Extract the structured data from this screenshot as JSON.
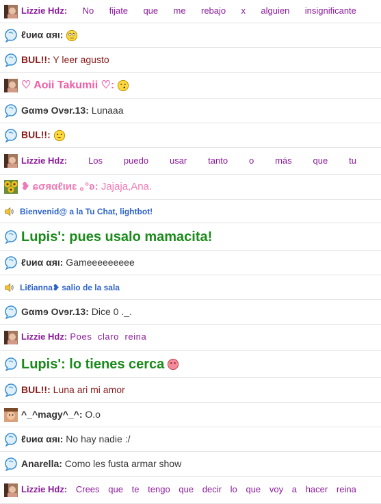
{
  "messages": [
    {
      "type": "chat",
      "avatar": "photo-avatar",
      "nick": "Lizzie Hdz",
      "text": "No fijate que me rebajo x alguien insignificante",
      "color": "#8b1a9b",
      "size": 13,
      "justify": true,
      "words": [
        "Lizzie Hdz:",
        "No",
        "fijate",
        "que",
        "me",
        "rebajo",
        "x",
        "alguien",
        "insignificante"
      ]
    },
    {
      "type": "chat",
      "avatar": "bubble-avatar",
      "nick": "ℓυиα αяι",
      "text": "",
      "emoji": "rolleyes-emoji",
      "color": "#333333",
      "size": 14
    },
    {
      "type": "chat",
      "avatar": "bubble-avatar",
      "nick": "BUL!!",
      "text": "Y leer agusto",
      "color": "#8b1a1a",
      "size": 14
    },
    {
      "type": "chat",
      "avatar": "photo-avatar",
      "nick": "♡ Aoii Takumii ♡",
      "text": "",
      "emoji": "whistle-emoji",
      "color": "#ee5fa5",
      "size": 16
    },
    {
      "type": "chat",
      "avatar": "bubble-avatar",
      "nick": "Gαmɘ Ovɘr.13",
      "text": "Lunaaa",
      "color": "#333333",
      "size": 14
    },
    {
      "type": "chat",
      "avatar": "bubble-avatar",
      "nick": "BUL!!",
      "text": "",
      "emoji": "thinking-emoji",
      "color": "#8b1a1a",
      "size": 14
    },
    {
      "type": "chat",
      "avatar": "photo-avatar",
      "nick": "Lizzie Hdz",
      "text": "Los puedo usar tanto o más que tu",
      "color": "#8b1a9b",
      "size": 13,
      "justify": true,
      "words": [
        "Lizzie Hdz:",
        "Los",
        "puedo",
        "usar",
        "tanto",
        "o",
        "más",
        "que",
        "tu"
      ]
    },
    {
      "type": "chat",
      "avatar": "flower-avatar",
      "nick": "❥ ɕσяαℓιиɛ ｡°ʚ",
      "text": "Jajaja,Ana.",
      "color": "#f07ab6",
      "size": 15
    },
    {
      "type": "system",
      "text": "Bienvenid@ a la Tu Chat, lightbot!"
    },
    {
      "type": "chat",
      "avatar": "bubble-avatar",
      "nick": "Lupis'",
      "text": "pues usalo mamacita!",
      "color": "#1a8a1a",
      "size": 20,
      "bold_text": true
    },
    {
      "type": "chat",
      "avatar": "bubble-avatar",
      "nick": "ℓυиα αяι",
      "text": "Gameeeeeeeee",
      "color": "#333333",
      "size": 14
    },
    {
      "type": "system",
      "text": "Liℓianna❥ salio de la sala"
    },
    {
      "type": "chat",
      "avatar": "bubble-avatar",
      "nick": "Gαmɘ Ovɘr.13",
      "text": "Dice 0 ._.",
      "color": "#333333",
      "size": 14
    },
    {
      "type": "chat",
      "avatar": "photo-avatar",
      "nick": "Lizzie Hdz",
      "text": "Poes claro reina",
      "color": "#8b1a9b",
      "size": 13,
      "words_spaced": true
    },
    {
      "type": "chat",
      "avatar": "bubble-avatar",
      "nick": "Lupis'",
      "text": "lo tienes cerca",
      "emoji": "blush-emoji",
      "color": "#1a8a1a",
      "size": 20,
      "bold_text": true
    },
    {
      "type": "chat",
      "avatar": "bubble-avatar",
      "nick": "BUL!!",
      "text": "Luna ari mi amor",
      "color": "#8b1a1a",
      "size": 14
    },
    {
      "type": "chat",
      "avatar": "face-avatar",
      "nick": "^_^magy^_^",
      "text": "O.o",
      "color": "#333333",
      "size": 14
    },
    {
      "type": "chat",
      "avatar": "bubble-avatar",
      "nick": "ℓυиα αяι",
      "text": "No hay nadie :/",
      "color": "#333333",
      "size": 14
    },
    {
      "type": "chat",
      "avatar": "bubble-avatar",
      "nick": "Anarella",
      "text": "Como les fusta armar show",
      "color": "#333333",
      "size": 14
    },
    {
      "type": "chat",
      "avatar": "photo-avatar",
      "nick": "Lizzie Hdz",
      "text": "Crees que te tengo que decir lo que voy a hacer reina",
      "color": "#8b1a9b",
      "size": 13,
      "justify": true,
      "words": [
        "Lizzie Hdz:",
        "Crees",
        "que",
        "te",
        "tengo",
        "que",
        "decir",
        "lo",
        "que",
        "voy",
        "a",
        "hacer",
        "reina"
      ]
    }
  ]
}
